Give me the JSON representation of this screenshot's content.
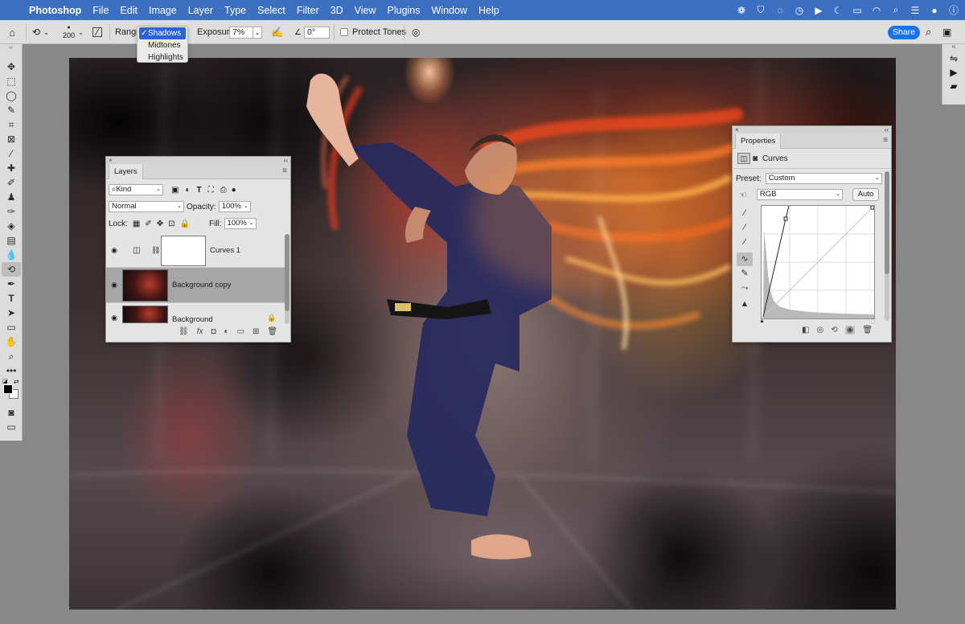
{
  "menubar": {
    "app_name": "Photoshop",
    "items": [
      "File",
      "Edit",
      "Image",
      "Layer",
      "Type",
      "Select",
      "Filter",
      "3D",
      "View",
      "Plugins",
      "Window",
      "Help"
    ]
  },
  "options_bar": {
    "brush_size": "200",
    "range_label": "Range",
    "range_options": [
      "Shadows",
      "Midtones",
      "Highlights"
    ],
    "range_selected": "Shadows",
    "exposure_label": "Exposure:",
    "exposure_value": "7%",
    "angle_value": "0°",
    "protect_tones_label": "Protect Tones",
    "share_label": "Share"
  },
  "layers_panel": {
    "tab": "Layers",
    "filter_kind": "Kind",
    "blend_mode": "Normal",
    "opacity_label": "Opacity:",
    "opacity_value": "100%",
    "lock_label": "Lock:",
    "fill_label": "Fill:",
    "fill_value": "100%",
    "layers": [
      {
        "name": "Curves 1",
        "type": "adjustment"
      },
      {
        "name": "Background copy",
        "type": "image"
      },
      {
        "name": "Background",
        "type": "image"
      }
    ]
  },
  "properties_panel": {
    "tab": "Properties",
    "adjustment_name": "Curves",
    "preset_label": "Preset:",
    "preset_value": "Custom",
    "channel_value": "RGB",
    "auto_label": "Auto"
  },
  "colors": {
    "menubar": "#3c6fc0",
    "accent": "#1a73e8",
    "selection": "#2b62d6"
  }
}
